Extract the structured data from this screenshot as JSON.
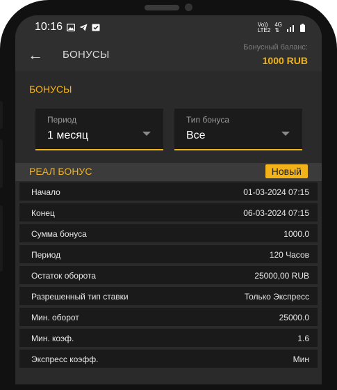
{
  "status_bar": {
    "time": "10:16",
    "network_label_top": "Vo))",
    "network_label_bottom": "LTE2",
    "network_gen": "4G"
  },
  "header": {
    "title": "БОНУСЫ",
    "balance_label": "Бонусный баланс:",
    "balance_value": "1000 RUB"
  },
  "section_title": "БОНУСЫ",
  "filters": {
    "period": {
      "label": "Период",
      "value": "1 месяц"
    },
    "bonus_type": {
      "label": "Тип бонуса",
      "value": "Все"
    }
  },
  "bonus": {
    "title": "РЕАЛ БОНУС",
    "badge": "Новый",
    "rows": [
      {
        "key": "Начало",
        "value": "01-03-2024 07:15"
      },
      {
        "key": "Конец",
        "value": "06-03-2024 07:15"
      },
      {
        "key": "Сумма бонуса",
        "value": "1000.0"
      },
      {
        "key": "Период",
        "value": "120 Часов"
      },
      {
        "key": "Остаток оборота",
        "value": "25000,00 RUB"
      },
      {
        "key": "Разрешенный тип ставки",
        "value": "Только Экспресс"
      },
      {
        "key": "Мин. оборот",
        "value": "25000.0"
      },
      {
        "key": "Мин. коэф.",
        "value": "1.6"
      },
      {
        "key": "Экспресс коэфф.",
        "value": "Мин"
      }
    ]
  },
  "colors": {
    "accent": "#f2b21a",
    "background": "#2a2a2a",
    "field": "#1b1b1b"
  }
}
